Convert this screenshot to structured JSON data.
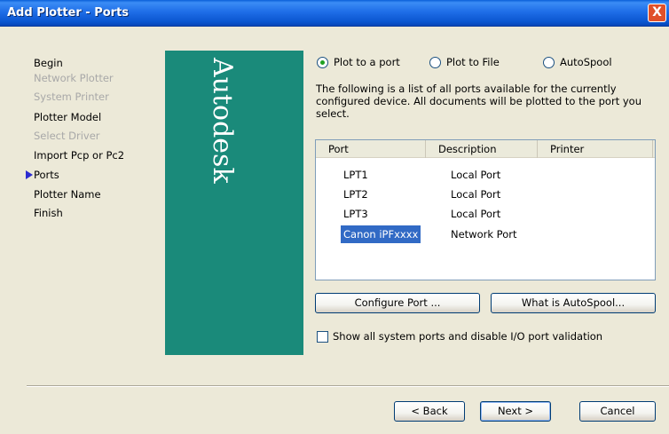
{
  "window": {
    "title": "Add Plotter - Ports",
    "close_glyph": "X"
  },
  "nav": {
    "items": [
      {
        "label": "Begin",
        "disabled": false
      },
      {
        "label": "Network Plotter",
        "disabled": true
      },
      {
        "label": "System Printer",
        "disabled": true
      },
      {
        "label": "Plotter Model",
        "disabled": false
      },
      {
        "label": "Select Driver",
        "disabled": true
      },
      {
        "label": "Import Pcp or Pc2",
        "disabled": false
      },
      {
        "label": "Ports",
        "disabled": false,
        "current": true
      },
      {
        "label": "Plotter Name",
        "disabled": false
      },
      {
        "label": "Finish",
        "disabled": false
      }
    ]
  },
  "banner": {
    "logo_text": "Autodesk",
    "color": "#1a8a7a"
  },
  "options": {
    "plot_to_port": "Plot to a port",
    "plot_to_file": "Plot to File",
    "autospool": "AutoSpool",
    "selected": "plot_to_port"
  },
  "description": "The following is a list of all ports available for the currently configured device. All documents will be plotted to the port you select.",
  "ports_table": {
    "headers": {
      "port": "Port",
      "description": "Description",
      "printer": "Printer"
    },
    "rows": [
      {
        "port": "LPT1",
        "description": "Local Port",
        "printer": ""
      },
      {
        "port": "LPT2",
        "description": "Local Port",
        "printer": ""
      },
      {
        "port": "LPT3",
        "description": "Local Port",
        "printer": ""
      },
      {
        "port": "Canon iPFxxxx",
        "description": "Network Port",
        "printer": "",
        "selected": true
      }
    ]
  },
  "buttons": {
    "configure_port": "Configure Port ...",
    "what_is_autospool": "What is AutoSpool...",
    "back": "< Back",
    "next": "Next >",
    "cancel": "Cancel"
  },
  "checkbox": {
    "label": "Show all system ports and disable I/O port validation",
    "checked": false
  },
  "colors": {
    "title_bar": "#0a55cf",
    "selection": "#316ac5",
    "dialog_bg": "#ece9d8"
  }
}
